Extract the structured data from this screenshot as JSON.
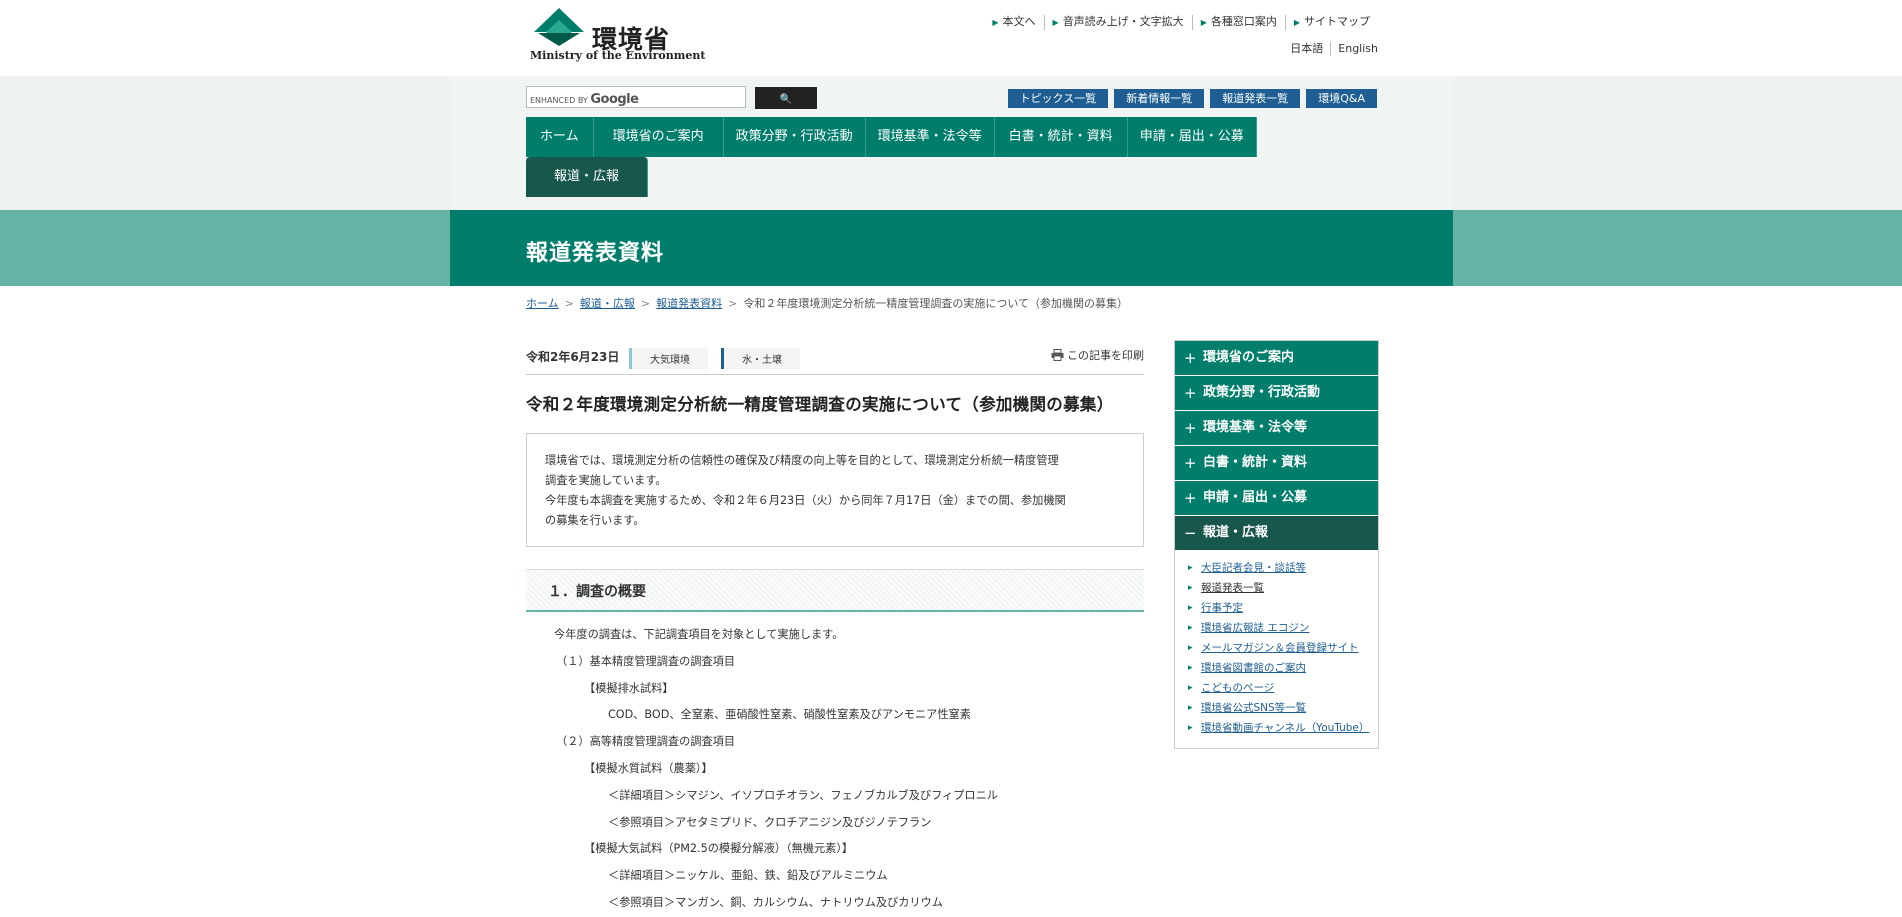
{
  "header": {
    "logo_jp": "環境省",
    "logo_en": "Ministry of the Environment",
    "util_links": [
      "本文へ",
      "音声読み上げ・文字拡大",
      "各種窓口案内",
      "サイトマップ"
    ],
    "lang": [
      "日本語",
      "English"
    ]
  },
  "search": {
    "prefix": "ENHANCED BY",
    "brand": "Google",
    "button_icon": "search-icon",
    "button_glyph": "🔍"
  },
  "quick_links": [
    "トピックス一覧",
    "新着情報一覧",
    "報道発表一覧",
    "環境Q&A"
  ],
  "global_nav": [
    "ホーム",
    "環境省のご案内",
    "政策分野・行政活動",
    "環境基準・法令等",
    "白書・統計・資料",
    "申請・届出・公募",
    "報道・広報"
  ],
  "page_title": "報道発表資料",
  "breadcrumb": [
    "ホーム",
    "報道・広報",
    "報道発表資料",
    "令和２年度環境測定分析統一精度管理調査の実施について（参加機関の募集）"
  ],
  "article": {
    "date": "令和2年6月23日",
    "tags": [
      "大気環境",
      "水・土壌"
    ],
    "print_label": "この記事を印刷",
    "title": "令和２年度環境測定分析統一精度管理調査の実施について（参加機関の募集）",
    "summary": [
      "環境省では、環境測定分析の信頼性の確保及び精度の向上等を目的として、環境測定分析統一精度管理",
      "調査を実施しています。",
      "今年度も本調査を実施するため、令和２年６月23日（火）から同年７月17日（金）までの間、参加機関",
      "の募集を行います。"
    ],
    "section_heading": "１．調査の概要",
    "lines": [
      {
        "indent": 28,
        "text": "今年度の調査は、下記調査項目を対象として実施します。"
      },
      {
        "indent": 30,
        "text": "（１）基本精度管理調査の調査項目"
      },
      {
        "indent": 58,
        "text": "【模擬排水試料】"
      },
      {
        "indent": 82,
        "text": "COD、BOD、全窒素、亜硝酸性窒素、硝酸性窒素及びアンモニア性窒素"
      },
      {
        "indent": 30,
        "text": "（２）高等精度管理調査の調査項目"
      },
      {
        "indent": 58,
        "text": "【模擬水質試料（農薬）】"
      },
      {
        "indent": 82,
        "text": "＜詳細項目＞シマジン、イソプロチオラン、フェノブカルブ及びフィプロニル"
      },
      {
        "indent": 82,
        "text": "＜参照項目＞アセタミプリド、クロチアニジン及びジノテフラン"
      },
      {
        "indent": 58,
        "text": "【模擬大気試料（PM2.5の模擬分解液）（無機元素）】"
      },
      {
        "indent": 82,
        "text": "＜詳細項目＞ニッケル、亜鉛、鉄、鉛及びアルミニウム"
      },
      {
        "indent": 82,
        "text": "＜参照項目＞マンガン、銅、カルシウム、ナトリウム及びカリウム"
      }
    ]
  },
  "side_nav": {
    "items": [
      {
        "label": "環境省のご案内",
        "sign": "+"
      },
      {
        "label": "政策分野・行政活動",
        "sign": "+"
      },
      {
        "label": "環境基準・法令等",
        "sign": "+"
      },
      {
        "label": "白書・統計・資料",
        "sign": "+"
      },
      {
        "label": "申請・届出・公募",
        "sign": "+"
      },
      {
        "label": "報道・広報",
        "sign": "−"
      }
    ],
    "subs": [
      "大臣記者会見・談話等",
      "報道発表一覧",
      "行事予定",
      "環境省広報誌 エコジン",
      "メールマガジン＆会員登録サイト",
      "環境省図書館のご案内",
      "こどものページ",
      "環境省公式SNS等一覧",
      "環境省動画チャンネル（YouTube）"
    ]
  },
  "colors": {
    "accent": "#007e6b",
    "accent_dark": "#17574c",
    "link_blue": "#1e5e92"
  }
}
